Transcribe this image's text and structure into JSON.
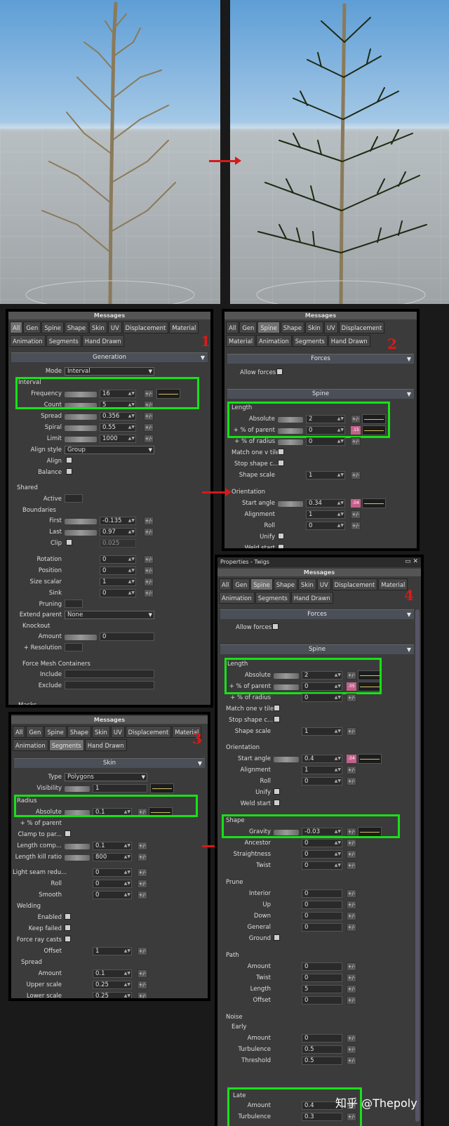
{
  "tabs": {
    "all": "All",
    "gen": "Gen",
    "spine": "Spine",
    "shape": "Shape",
    "skin": "Skin",
    "uv": "UV",
    "displacement": "Displacement",
    "material": "Material",
    "animation": "Animation",
    "segments": "Segments",
    "hand_drawn": "Hand Drawn"
  },
  "messages": "Messages",
  "sectpanel": {
    "title": "Properties - Twigs"
  },
  "p1": {
    "section": "Generation",
    "mode_label": "Mode",
    "mode_value": "Interval",
    "interval": "Interval",
    "frequency_label": "Frequency",
    "frequency_value": "16",
    "count_label": "Count",
    "count_value": "5",
    "spread_label": "Spread",
    "spread_value": "0.356",
    "spiral_label": "Spiral",
    "spiral_value": "0.55",
    "limit_label": "Limit",
    "limit_value": "1000",
    "align_style_label": "Align style",
    "align_style_value": "Group",
    "align_label": "Align",
    "balance_label": "Balance",
    "shared": "Shared",
    "active_label": "Active",
    "boundaries": "Boundaries",
    "first_label": "First",
    "first_value": "-0.135",
    "last_label": "Last",
    "last_value": "0.97",
    "clip_label": "Clip",
    "clip_value": "0.025",
    "rotation_label": "Rotation",
    "rotation_value": "0",
    "position_label": "Position",
    "position_value": "0",
    "size_scalar_label": "Size scalar",
    "size_scalar_value": "1",
    "sink_label": "Sink",
    "sink_value": "0",
    "pruning_label": "Pruning",
    "extend_parent_label": "Extend parent",
    "extend_parent_value": "None",
    "knockout": "Knockout",
    "amount_label": "Amount",
    "amount_value": "0",
    "resolution_label": "+ Resolution",
    "fmc": "Force Mesh Containers",
    "include_label": "Include",
    "exclude_label": "Exclude",
    "masks": "Masks"
  },
  "p2": {
    "forces": "Forces",
    "allow_forces_label": "Allow forces",
    "spine": "Spine",
    "length": "Length",
    "absolute_label": "Absolute",
    "absolute_value": "2",
    "pct_parent_label": "+ % of parent",
    "pct_parent_value": "0",
    "pct_parent_pink": ".15",
    "pct_radius_label": "+ % of radius",
    "pct_radius_value": "0",
    "match_label": "Match one v tile",
    "stop_label": "Stop shape c...",
    "shape_scale_label": "Shape scale",
    "shape_scale_value": "1",
    "orientation": "Orientation",
    "start_angle_label": "Start angle",
    "start_angle_value": "0.34",
    "start_angle_pink": ".04",
    "alignment_label": "Alignment",
    "alignment_value": "1",
    "roll_label": "Roll",
    "roll_value": "0",
    "unify_label": "Unify",
    "weld_label": "Weld start"
  },
  "p3": {
    "type_label": "Type",
    "type_value": "Polygons",
    "visibility_label": "Visibility",
    "visibility_value": "1",
    "skin": "Skin",
    "radius": "Radius",
    "absolute_label": "Absolute",
    "absolute_value": "0.1",
    "pct_parent_label": "+ % of parent",
    "clamp_label": "Clamp to par...",
    "length_comp_label": "Length comp...",
    "length_comp_value": "0.1",
    "length_kill_label": "Length kill ratio",
    "length_kill_value": "800",
    "light_seam_label": "Light seam redu...",
    "light_seam_value": "0",
    "roll_label": "Roll",
    "roll_value": "0",
    "smooth_label": "Smooth",
    "smooth_value": "0",
    "welding": "Welding",
    "enabled_label": "Enabled",
    "keep_failed_label": "Keep failed",
    "force_ray_label": "Force ray casts",
    "offset_label": "Offset",
    "offset_value": "1",
    "spread": "Spread",
    "amount_label": "Amount",
    "amount_value": "0.1",
    "upper_label": "Upper scale",
    "upper_value": "0.25",
    "lower_label": "Lower scale",
    "lower_value": "0.25"
  },
  "p4": {
    "absolute_value": "2",
    "pct_parent_value": "0",
    "pct_parent_pink": ".05",
    "pct_radius_value": "0",
    "shape_scale_value": "1",
    "start_angle_value": "0.4",
    "start_angle_pink": ".04",
    "alignment_value": "1",
    "roll_value": "0",
    "shape": "Shape",
    "gravity_label": "Gravity",
    "gravity_value": "-0.03",
    "ancestor_label": "Ancestor",
    "ancestor_value": "0",
    "straightness_label": "Straightness",
    "straightness_value": "0",
    "twist_label": "Twist",
    "twist_value": "0",
    "prune": "Prune",
    "interior_label": "Interior",
    "up_label": "Up",
    "down_label": "Down",
    "general_label": "General",
    "ground_label": "Ground",
    "zero": "0",
    "path": "Path",
    "path_amount_label": "Amount",
    "path_twist_label": "Twist",
    "path_length_label": "Length",
    "path_length_value": "5",
    "path_offset_label": "Offset",
    "noise": "Noise",
    "early": "Early",
    "turbulence_label": "Turbulence",
    "turbulence_value": "0.5",
    "threshold_label": "Threshold",
    "threshold_value": "0.5",
    "late": "Late",
    "late_amount_value": "0.4",
    "late_turbulence_value": "0.3"
  },
  "annotations": {
    "n1": "1",
    "n2": "2",
    "n3": "3",
    "n4": "4"
  },
  "watermark": "知乎 @Thepoly"
}
